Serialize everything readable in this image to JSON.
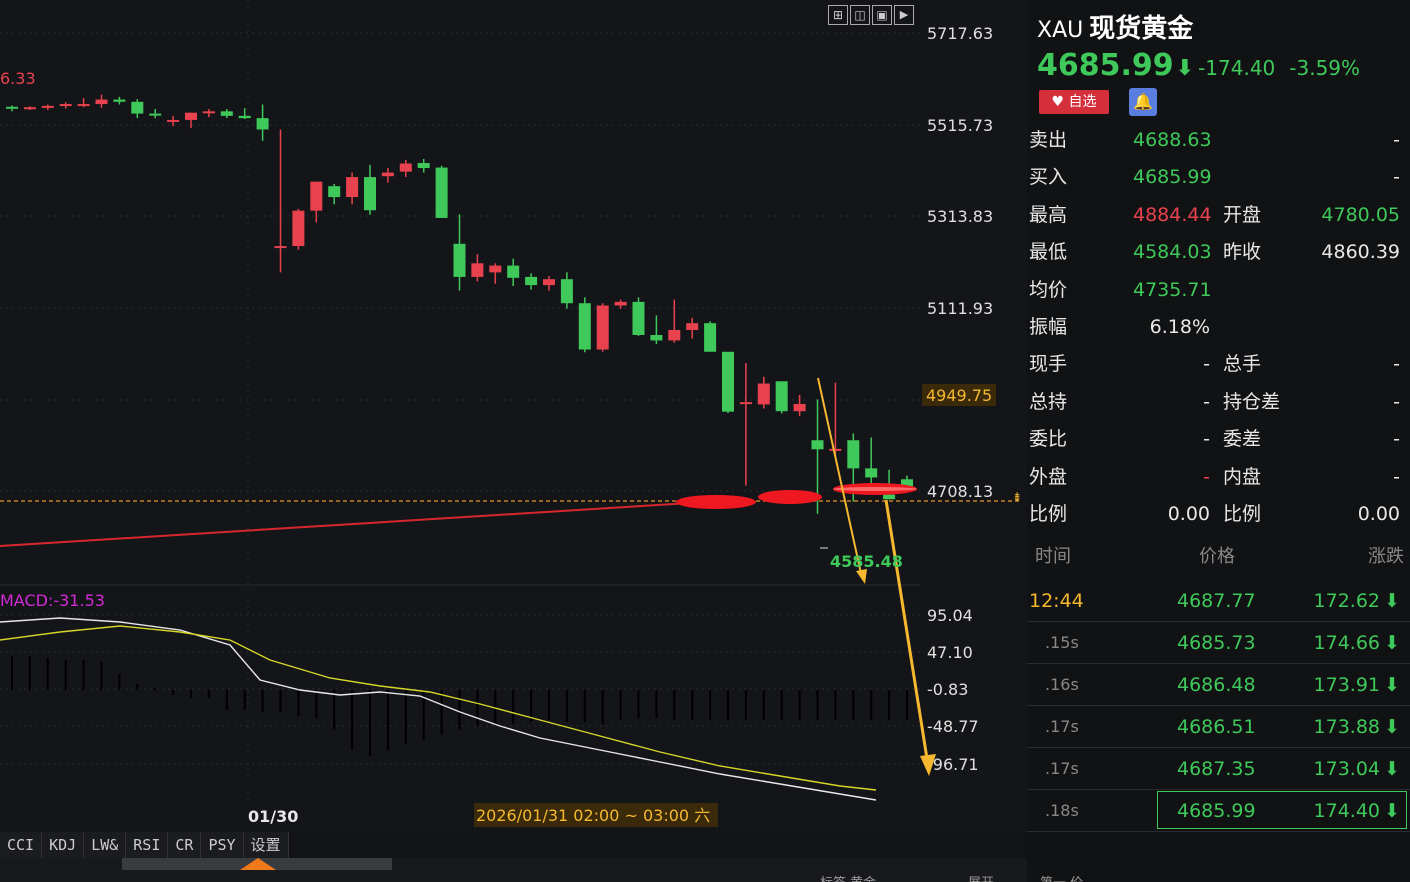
{
  "header": {
    "code": "XAU",
    "name": "现货黄金"
  },
  "quote": {
    "price": "4685.99",
    "change": "-174.40",
    "pct": "-3.59%",
    "arrow": "⬇"
  },
  "buttons": {
    "fav": "♥ 自选",
    "bell": "🔔"
  },
  "stats": [
    {
      "l": "卖出",
      "v": "4688.63",
      "l2": "",
      "v2": "-"
    },
    {
      "l": "买入",
      "v": "4685.99",
      "l2": "",
      "v2": "-"
    },
    {
      "l": "最高",
      "v": "4884.44",
      "l2": "开盘",
      "v2": "4780.05"
    },
    {
      "l": "最低",
      "v": "4584.03",
      "l2": "昨收",
      "v2": "4860.39"
    },
    {
      "l": "均价",
      "v": "4735.71",
      "l2": "",
      "v2": ""
    },
    {
      "l": "振幅",
      "v": "6.18%",
      "l2": "",
      "v2": ""
    },
    {
      "l": "现手",
      "v": "-",
      "l2": "总手",
      "v2": "-"
    },
    {
      "l": "总持",
      "v": "-",
      "l2": "持仓差",
      "v2": "-"
    },
    {
      "l": "委比",
      "v": "-",
      "l2": "委差",
      "v2": "-"
    },
    {
      "l": "外盘",
      "v": "-",
      "l2": "内盘",
      "v2": "-"
    },
    {
      "l": "比例",
      "v": "0.00",
      "l2": "比例",
      "v2": "0.00"
    }
  ],
  "ticks": {
    "headers": [
      "时间",
      "价格",
      "涨跌"
    ],
    "rows": [
      {
        "t": "12:44",
        "p": "4687.77",
        "c": "172.62"
      },
      {
        "t": ".15s",
        "p": "4685.73",
        "c": "174.66"
      },
      {
        "t": ".16s",
        "p": "4686.48",
        "c": "173.91"
      },
      {
        "t": ".17s",
        "p": "4686.51",
        "c": "173.88"
      },
      {
        "t": ".17s",
        "p": "4687.35",
        "c": "173.04"
      },
      {
        "t": ".18s",
        "p": "4685.99",
        "c": "174.40"
      }
    ],
    "down": "⬇"
  },
  "chart": {
    "price_axis": [
      "5717.63",
      "5515.73",
      "5313.83",
      "5111.93",
      "4949.75",
      "4708.13"
    ],
    "macd_axis": [
      "95.04",
      "47.10",
      "-0.83",
      "-48.77",
      "-96.71"
    ],
    "left_label": "6.33",
    "low_label": "4585.48",
    "macd_label": "MACD:-31.53",
    "date_label": "01/30",
    "time_range": "2026/01/31 02:00 ~ 03:00 六"
  },
  "tabs": [
    "CCI",
    "KDJ",
    "LW&",
    "RSI",
    "CR",
    "PSY",
    "设置"
  ],
  "bottom": {
    "t1": "标签 黄金",
    "t2": "展开",
    "t3": "第一 价"
  },
  "colors": {
    "up": "#e8424e",
    "down": "#3ec95a",
    "accent": "#f5b82e"
  },
  "chart_data": {
    "type": "candlestick",
    "candles": [
      [
        5555,
        5558,
        5545,
        5552
      ],
      [
        5552,
        5556,
        5548,
        5554
      ],
      [
        5554,
        5560,
        5548,
        5557
      ],
      [
        5557,
        5565,
        5551,
        5561
      ],
      [
        5561,
        5574,
        5554,
        5561
      ],
      [
        5561,
        5582,
        5553,
        5571
      ],
      [
        5571,
        5577,
        5560,
        5566
      ],
      [
        5566,
        5572,
        5530,
        5540
      ],
      [
        5540,
        5550,
        5530,
        5538
      ],
      [
        5522,
        5535,
        5512,
        5526
      ],
      [
        5526,
        5542,
        5508,
        5542
      ],
      [
        5542,
        5550,
        5532,
        5545
      ],
      [
        5545,
        5550,
        5530,
        5535
      ],
      [
        5535,
        5552,
        5528,
        5530
      ],
      [
        5530,
        5560,
        5480,
        5505
      ],
      [
        5248,
        5505,
        5190,
        5248
      ],
      [
        5248,
        5330,
        5240,
        5326
      ],
      [
        5326,
        5380,
        5300,
        5390
      ],
      [
        5380,
        5385,
        5340,
        5356
      ],
      [
        5356,
        5410,
        5340,
        5400
      ],
      [
        5400,
        5427,
        5317,
        5327
      ],
      [
        5402,
        5420,
        5388,
        5410
      ],
      [
        5412,
        5438,
        5400,
        5430
      ],
      [
        5431,
        5440,
        5410,
        5420
      ],
      [
        5421,
        5425,
        5310,
        5310
      ],
      [
        5253,
        5318,
        5150,
        5180
      ],
      [
        5180,
        5230,
        5170,
        5210
      ],
      [
        5190,
        5210,
        5165,
        5205
      ],
      [
        5205,
        5220,
        5160,
        5178
      ],
      [
        5180,
        5188,
        5152,
        5162
      ],
      [
        5162,
        5182,
        5150,
        5175
      ],
      [
        5175,
        5190,
        5110,
        5122
      ],
      [
        5122,
        5135,
        5014,
        5020
      ],
      [
        5020,
        5122,
        5015,
        5117
      ],
      [
        5117,
        5130,
        5110,
        5125
      ],
      [
        5125,
        5135,
        5050,
        5052
      ],
      [
        5052,
        5095,
        5032,
        5040
      ],
      [
        5040,
        5130,
        5035,
        5063
      ],
      [
        5063,
        5090,
        5044,
        5078
      ],
      [
        5078,
        5082,
        5017,
        5015
      ],
      [
        5015,
        4900,
        4880,
        4883
      ],
      [
        4904,
        4990,
        4720,
        4904
      ],
      [
        4899,
        4960,
        4890,
        4945
      ],
      [
        4950,
        4945,
        4879,
        4884
      ],
      [
        4884,
        4920,
        4873,
        4900
      ],
      [
        4820,
        4910,
        4658,
        4800
      ],
      [
        4800,
        4947,
        4780,
        4801
      ],
      [
        4820,
        4835,
        4685,
        4758
      ],
      [
        4758,
        4826,
        4720,
        4738
      ],
      [
        4700,
        4755,
        4690,
        4690
      ],
      [
        4734,
        4742,
        4710,
        4712
      ]
    ],
    "ma_line": {
      "from": 4595,
      "to": 4708
    },
    "macd_value": -31.53,
    "last_price": 4685.99,
    "y_range": [
      4550,
      5717.63
    ]
  }
}
